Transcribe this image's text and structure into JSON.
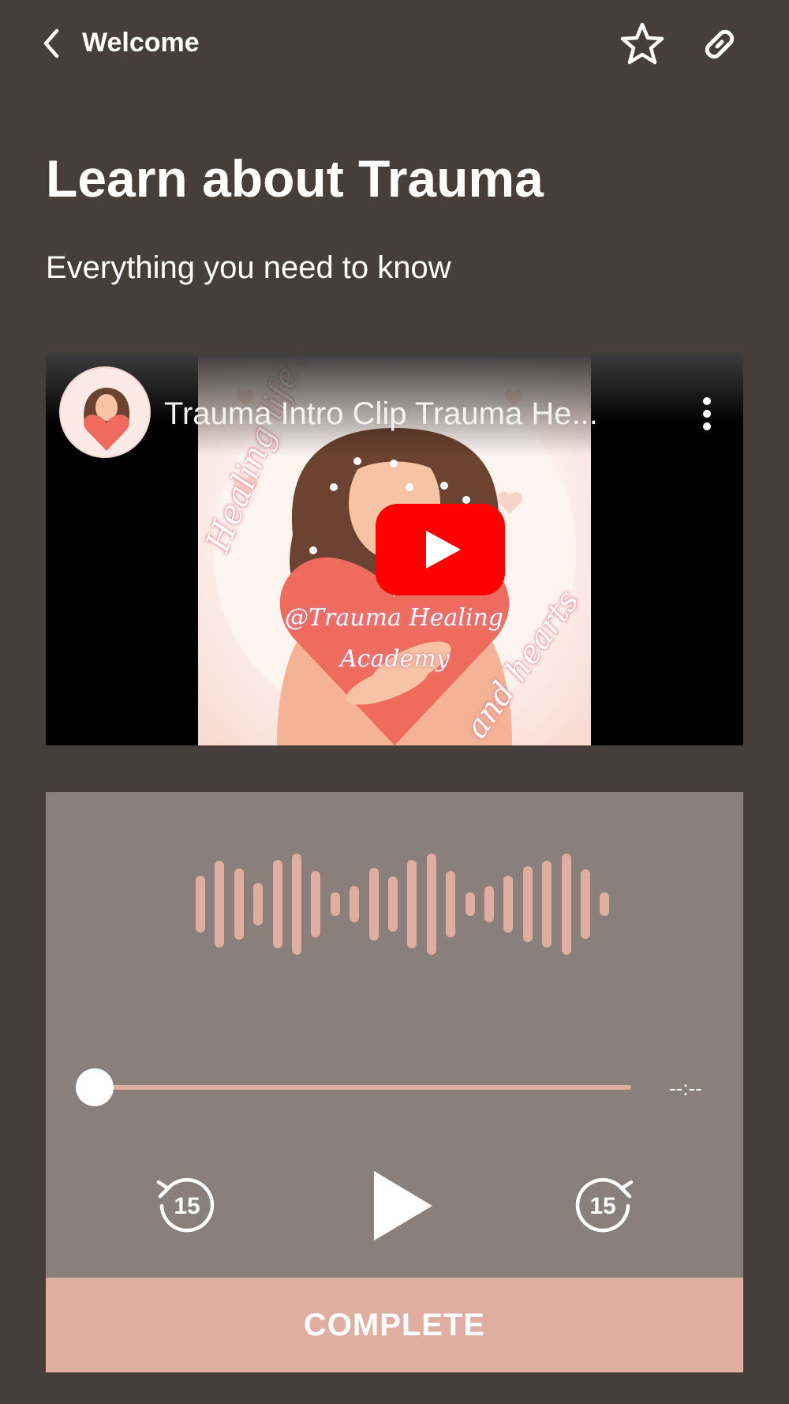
{
  "header": {
    "back_label": "Welcome",
    "icons": [
      "back-chevron-icon",
      "star-icon",
      "link-icon"
    ]
  },
  "page": {
    "title": "Learn about Trauma",
    "subtitle": "Everything you need to know"
  },
  "video": {
    "title": "Trauma Intro Clip Trauma He...",
    "thumbnail_text": {
      "arc_top": "Healing life's hurts",
      "handle_line1": "@Trauma Healing",
      "handle_line2": "Academy",
      "arc_bottom": "and hearts"
    },
    "icons": [
      "channel-avatar",
      "more-vertical-icon",
      "youtube-play-icon"
    ]
  },
  "audio": {
    "time": "--:--",
    "progress": 0,
    "skip_back_seconds": "15",
    "skip_forward_seconds": "15",
    "icons": [
      "waveform-icon",
      "rewind-15-icon",
      "play-icon",
      "forward-15-icon"
    ]
  },
  "actions": {
    "complete_label": "COMPLETE"
  },
  "colors": {
    "background": "#463e3a",
    "audio_card": "#8a807b",
    "accent": "#e0aea1",
    "youtube_red": "#ff0000"
  }
}
